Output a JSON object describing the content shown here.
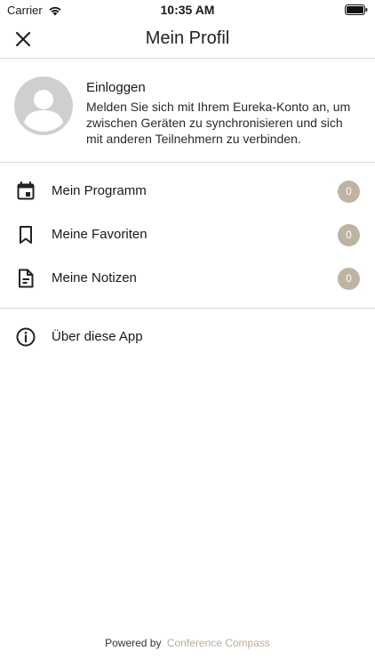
{
  "status_bar": {
    "carrier": "Carrier",
    "time": "10:35 AM"
  },
  "nav": {
    "title": "Mein Profil"
  },
  "login": {
    "title": "Einloggen",
    "description": "Melden Sie sich mit Ihrem Eureka-Konto an, um zwischen Geräten zu synchronisieren und sich mit anderen Teilnehmern zu verbinden."
  },
  "menu": {
    "items": [
      {
        "label": "Mein Programm",
        "count": "0",
        "icon": "calendar-icon"
      },
      {
        "label": "Meine Favoriten",
        "count": "0",
        "icon": "bookmark-icon"
      },
      {
        "label": "Meine Notizen",
        "count": "0",
        "icon": "note-icon"
      }
    ],
    "about": {
      "label": "Über diese App",
      "icon": "info-icon"
    }
  },
  "footer": {
    "powered_by": "Powered by",
    "brand": "Conference Compass"
  },
  "colors": {
    "badge": "#bfb3a1",
    "brand": "#b9ad98",
    "divider": "#d9d9d9"
  }
}
